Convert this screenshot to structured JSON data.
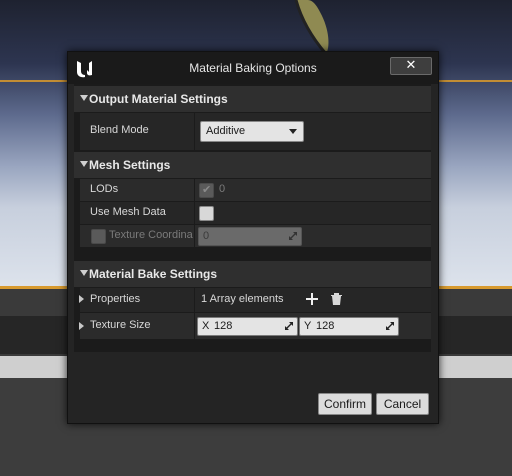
{
  "dialog": {
    "title": "Material Baking Options",
    "close_icon": "close-icon",
    "logo_icon": "unreal-logo-icon"
  },
  "sections": {
    "output": {
      "header": "Output Material Settings",
      "blend_mode": {
        "label": "Blend Mode",
        "value": "Additive"
      }
    },
    "mesh": {
      "header": "Mesh Settings",
      "lods": {
        "label": "LODs",
        "checked": true,
        "disabled": true,
        "value": "0"
      },
      "use_mesh_data": {
        "label": "Use Mesh Data",
        "checked": false
      },
      "texture_coordinate": {
        "label": "Texture Coordina",
        "value": "0",
        "disabled": true
      }
    },
    "bake": {
      "header": "Material Bake Settings",
      "properties": {
        "label": "Properties",
        "value": "1 Array elements"
      },
      "texture_size": {
        "label": "Texture Size",
        "x_axis": "X",
        "x": "128",
        "y_axis": "Y",
        "y": "128"
      }
    }
  },
  "buttons": {
    "confirm": "Confirm",
    "cancel": "Cancel"
  },
  "colors": {
    "accent_orange": "#d79a2f",
    "dialog_bg": "#242424"
  }
}
